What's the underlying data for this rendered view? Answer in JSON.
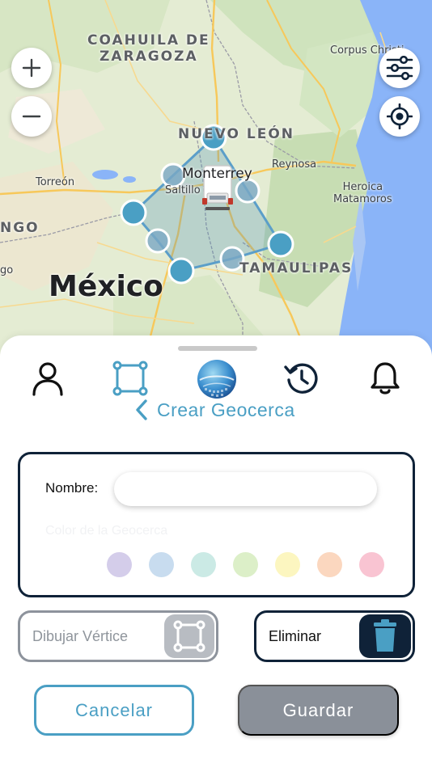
{
  "map": {
    "labels": {
      "region_coahuila_line1": "COAHUILA DE",
      "region_coahuila_line2": "ZARAGOZA",
      "region_nuevo_leon": "NUEVO LEÓN",
      "region_tamaulipas": "TAMAULIPAS",
      "city_monterrey": "Monterrey",
      "city_saltillo": "Saltillo",
      "city_torreon": "Torreón",
      "city_reynosa": "Reynosa",
      "city_heroica_line1": "Heroica",
      "city_heroica_line2": "Matamoros",
      "city_corpus": "Corpus Christi",
      "region_durango_fragment": "NGO",
      "city_fragment_go": "go",
      "country": "México"
    },
    "zoom_in_icon": "plus-icon",
    "zoom_out_icon": "minus-icon",
    "filter_icon": "sliders-icon",
    "locate_icon": "crosshair-icon",
    "vehicle_icon": "truck-icon",
    "polygon_fill": "#4a8fb8",
    "vertex_color": "#4a9fc4"
  },
  "nav": {
    "items": [
      {
        "icon": "user-icon"
      },
      {
        "icon": "polygon-icon"
      },
      {
        "icon": "globe-logo-icon"
      },
      {
        "icon": "history-icon"
      },
      {
        "icon": "bell-icon"
      }
    ]
  },
  "breadcrumb": {
    "back_icon": "chevron-left-icon",
    "title": "Crear Geocerca"
  },
  "form": {
    "name_label": "Nombre:",
    "name_value": "",
    "color_label": "Color de la Geocerca",
    "swatches": [
      "#d4cdea",
      "#c8dcef",
      "#cbeae5",
      "#dcefc8",
      "#fcf6c0",
      "#fbd7bf",
      "#f9c4d2"
    ]
  },
  "actions": {
    "draw_label": "Dibujar Vértice",
    "delete_label": "Eliminar",
    "draw_icon": "vertex-square-icon",
    "delete_icon": "trash-icon"
  },
  "buttons": {
    "cancel": "Cancelar",
    "save": "Guardar"
  },
  "colors": {
    "accent": "#4a9fc4",
    "navy": "#0f2238",
    "disabled": "#8a9099"
  }
}
